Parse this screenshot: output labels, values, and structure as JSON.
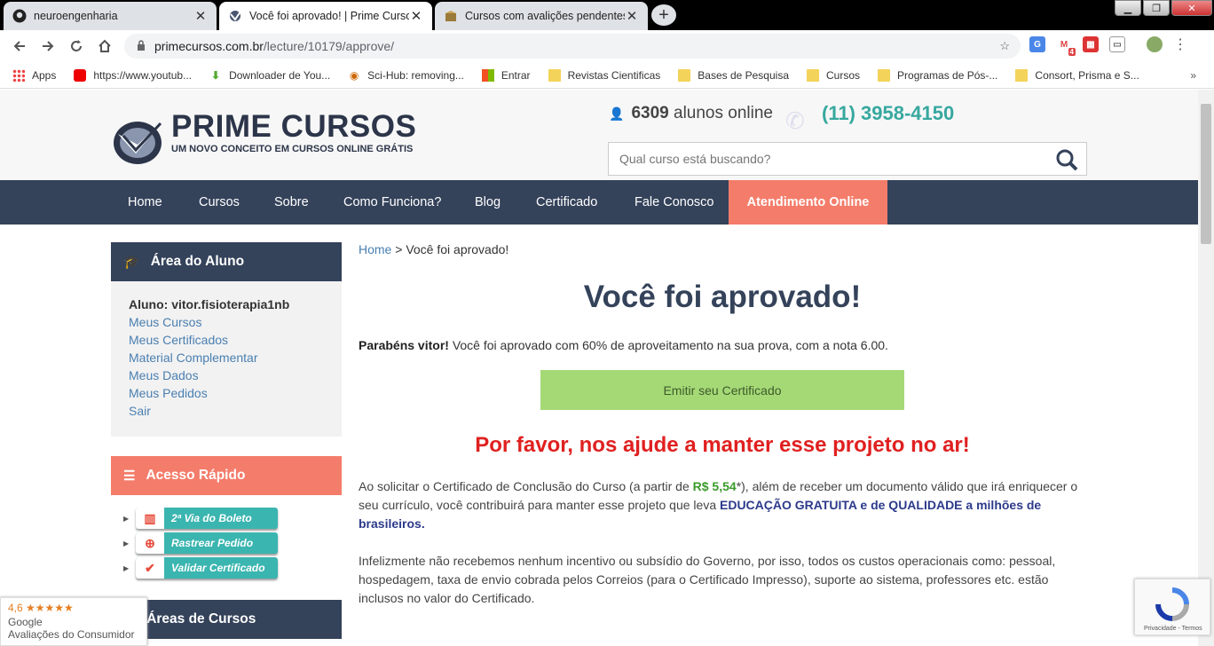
{
  "browser": {
    "tabs": [
      {
        "title": "neuroengenharia",
        "icon": "github-icon"
      },
      {
        "title": "Você foi aprovado! | Prime Curso",
        "icon": "prime-icon"
      },
      {
        "title": "Cursos com avalições pendentes",
        "icon": "box-icon"
      }
    ],
    "active_tab": 1,
    "url_host": "primecursos.com.br",
    "url_path": "/lecture/10179/approve/",
    "gmail_badge": "4",
    "bookmarks": [
      {
        "label": "Apps",
        "icon": "apps-icon"
      },
      {
        "label": "https://www.youtub...",
        "icon": "youtube-icon"
      },
      {
        "label": "Downloader de You...",
        "icon": "download-icon"
      },
      {
        "label": "Sci-Hub: removing...",
        "icon": "scihub-icon"
      },
      {
        "label": "Entrar",
        "icon": "microsoft-icon"
      },
      {
        "label": "Revistas Cientificas",
        "icon": "folder-icon"
      },
      {
        "label": "Bases de Pesquisa",
        "icon": "folder-icon"
      },
      {
        "label": "Cursos",
        "icon": "folder-icon"
      },
      {
        "label": "Programas de Pós-...",
        "icon": "folder-icon"
      },
      {
        "label": "Consort, Prisma e S...",
        "icon": "folder-icon"
      }
    ]
  },
  "header": {
    "logo_title": "PRIME CURSOS",
    "logo_tagline": "UM NOVO CONCEITO EM CURSOS ONLINE GRÁTIS",
    "online_count": "6309",
    "online_suffix": "alunos online",
    "phone": "(11) 3958-4150",
    "search_placeholder": "Qual curso está buscando?"
  },
  "nav": [
    "Home",
    "Cursos",
    "Sobre",
    "Como Funciona?",
    "Blog",
    "Certificado",
    "Fale Conosco",
    "Atendimento Online"
  ],
  "sidebar": {
    "area_title": "Área do Aluno",
    "aluno_label": "Aluno: vitor.fisioterapia1nb",
    "links": [
      "Meus Cursos",
      "Meus Certificados",
      "Material Complementar",
      "Meus Dados",
      "Meus Pedidos",
      "Sair"
    ],
    "acesso_title": "Acesso Rápido",
    "quick": [
      "2ª Via do Boleto",
      "Rastrear Pedido",
      "Validar Certificado"
    ],
    "areas_title": "Áreas de Cursos"
  },
  "content": {
    "breadcrumb_home": "Home",
    "breadcrumb_sep": " > ",
    "breadcrumb_current": "Você foi aprovado!",
    "title": "Você foi aprovado!",
    "congrats_bold": "Parabéns vitor!",
    "congrats_text": " Você foi aprovado com 60% de aproveitamento na sua prova, com a nota 6.00.",
    "cert_button": "Emitir seu Certificado",
    "help_title": "Por favor, nos ajude a manter esse projeto no ar!",
    "p1_a": "Ao solicitar o Certificado de Conclusão do Curso (a partir de ",
    "p1_price": "R$ 5,54",
    "p1_b": "*), além de receber um documento válido que irá enriquecer o seu currículo, você contribuirá para manter esse projeto que leva ",
    "p1_edu": "EDUCAÇÃO GRATUITA e de QUALIDADE a milhões de brasileiros.",
    "p2": "Infelizmente não recebemos nenhum incentivo ou subsídio do Governo, por isso, todos os custos operacionais como: pessoal, hospedagem, taxa de envio cobrada pelos Correios (para o Certificado Impresso), suporte ao sistema, professores etc. estão inclusos no valor do Certificado."
  },
  "google_badge": {
    "rating": "4,6 ★★★★★",
    "brand": "Google",
    "subtitle": "Avaliações do Consumidor"
  },
  "recaptcha_text": "Privacidade - Termos",
  "colors": {
    "nav_bg": "#34425a",
    "accent_coral": "#f47c6a",
    "teal": "#37a89f",
    "cert_green": "#a5d976",
    "alert_red": "#e02020"
  }
}
